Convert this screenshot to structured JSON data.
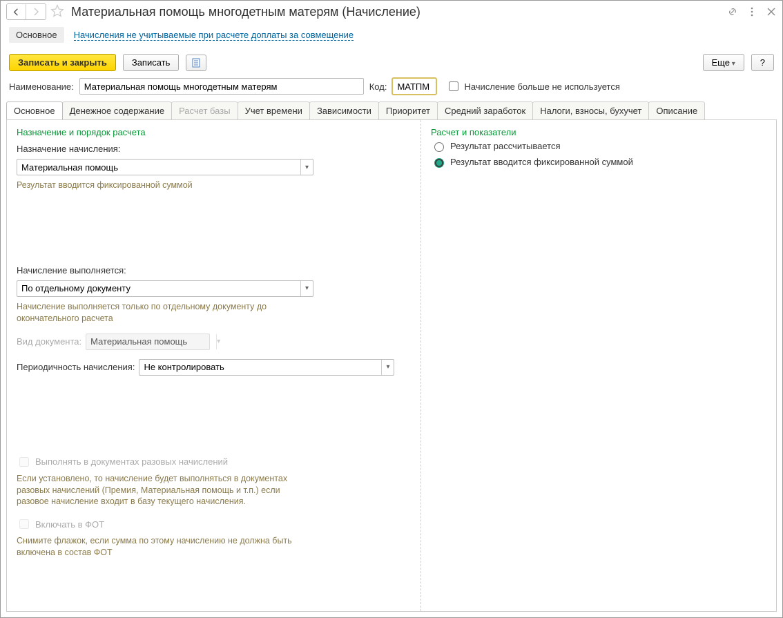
{
  "header": {
    "title": "Материальная помощь многодетным матерям (Начисление)"
  },
  "navlinks": {
    "main": "Основное",
    "link1": "Начисления не учитываемые при расчете доплаты за совмещение"
  },
  "toolbar": {
    "save_close": "Записать и закрыть",
    "save": "Записать",
    "more": "Еще",
    "help": "?"
  },
  "fields": {
    "name_label": "Наименование:",
    "name_value": "Материальная помощь многодетным матерям",
    "code_label": "Код:",
    "code_value": "МАТПМ",
    "unused_label": "Начисление больше не используется"
  },
  "tabs": [
    {
      "label": "Основное",
      "active": true
    },
    {
      "label": "Денежное содержание"
    },
    {
      "label": "Расчет базы",
      "disabled": true
    },
    {
      "label": "Учет времени"
    },
    {
      "label": "Зависимости"
    },
    {
      "label": "Приоритет"
    },
    {
      "label": "Средний заработок"
    },
    {
      "label": "Налоги, взносы, бухучет"
    },
    {
      "label": "Описание"
    }
  ],
  "left": {
    "section1": "Назначение и порядок расчета",
    "purpose_label": "Назначение начисления:",
    "purpose_value": "Материальная помощь",
    "hint1": "Результат вводится фиксированной суммой",
    "perform_label": "Начисление выполняется:",
    "perform_value": "По отдельному документу",
    "hint2": "Начисление выполняется только по отдельному документу до окончательного расчета",
    "doc_label": "Вид документа:",
    "doc_value": "Материальная помощь",
    "period_label": "Периодичность начисления:",
    "period_value": "Не контролировать",
    "chk_onceoff": "Выполнять в документах разовых начислений",
    "hint_onceoff": "Если установлено, то начисление будет выполняться в документах разовых начислений (Премия, Материальная помощь и т.п.) если разовое начисление входит в базу текущего начисления.",
    "chk_fot": "Включать в ФОТ",
    "hint_fot": "Снимите флажок, если сумма по этому начислению не должна быть включена в состав ФОТ"
  },
  "right": {
    "section": "Расчет и показатели",
    "radio1": "Результат рассчитывается",
    "radio2": "Результат вводится фиксированной суммой"
  }
}
